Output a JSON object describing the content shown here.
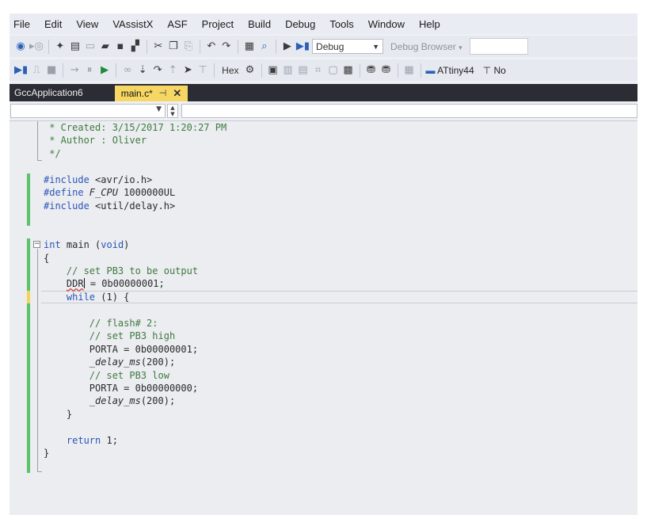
{
  "menu": [
    "File",
    "Edit",
    "View",
    "VAssistX",
    "ASF",
    "Project",
    "Build",
    "Debug",
    "Tools",
    "Window",
    "Help"
  ],
  "toolbar": {
    "config_value": "Debug",
    "debug_browser_label": "Debug Browser",
    "hex_label": "Hex",
    "device_label": "ATtiny44",
    "tool_label": "No"
  },
  "tabs": {
    "project": "GccApplication6",
    "file": "main.c*",
    "pin_glyph": "⊣",
    "close_glyph": "✕"
  },
  "editor": {
    "lines": [
      {
        "tokens": [
          {
            "t": " * Created: 3/15/2017 1:20:27 PM",
            "c": "cm"
          }
        ]
      },
      {
        "tokens": [
          {
            "t": " * Author : Oliver",
            "c": "cm"
          }
        ]
      },
      {
        "tokens": [
          {
            "t": " */",
            "c": "cm"
          }
        ]
      },
      {
        "tokens": []
      },
      {
        "tokens": [
          {
            "t": "#include ",
            "c": "kw"
          },
          {
            "t": "<avr/io.h>",
            "c": ""
          }
        ]
      },
      {
        "tokens": [
          {
            "t": "#define ",
            "c": "kw"
          },
          {
            "t": "F_CPU",
            "c": "it"
          },
          {
            "t": " 1000000UL",
            "c": ""
          }
        ]
      },
      {
        "tokens": [
          {
            "t": "#include ",
            "c": "kw"
          },
          {
            "t": "<util/delay.h>",
            "c": ""
          }
        ]
      },
      {
        "tokens": []
      },
      {
        "tokens": []
      },
      {
        "tokens": [
          {
            "t": "int",
            "c": "kw"
          },
          {
            "t": " main (",
            "c": ""
          },
          {
            "t": "void",
            "c": "kw"
          },
          {
            "t": ")",
            "c": ""
          }
        ]
      },
      {
        "tokens": [
          {
            "t": "{",
            "c": ""
          }
        ]
      },
      {
        "tokens": [
          {
            "t": "    ",
            "c": ""
          },
          {
            "t": "// set PB3 to be output",
            "c": "cm"
          }
        ]
      },
      {
        "tokens": [
          {
            "t": "    ",
            "c": ""
          },
          {
            "t": "DDR",
            "c": "squig"
          },
          {
            "t": "|",
            "c": "caret"
          },
          {
            "t": " = 0b00000001;",
            "c": ""
          }
        ]
      },
      {
        "tokens": [
          {
            "t": "    ",
            "c": ""
          },
          {
            "t": "while",
            "c": "kw"
          },
          {
            "t": " (1) {",
            "c": ""
          }
        ]
      },
      {
        "tokens": []
      },
      {
        "tokens": [
          {
            "t": "        ",
            "c": ""
          },
          {
            "t": "// flash# 2:",
            "c": "cm"
          }
        ]
      },
      {
        "tokens": [
          {
            "t": "        ",
            "c": ""
          },
          {
            "t": "// set PB3 high",
            "c": "cm"
          }
        ]
      },
      {
        "tokens": [
          {
            "t": "        PORTA = 0b00000001;",
            "c": ""
          }
        ]
      },
      {
        "tokens": [
          {
            "t": "        ",
            "c": ""
          },
          {
            "t": "_delay_ms",
            "c": "it"
          },
          {
            "t": "(200);",
            "c": ""
          }
        ]
      },
      {
        "tokens": [
          {
            "t": "        ",
            "c": ""
          },
          {
            "t": "// set PB3 low",
            "c": "cm"
          }
        ]
      },
      {
        "tokens": [
          {
            "t": "        PORTA = 0b00000000;",
            "c": ""
          }
        ]
      },
      {
        "tokens": [
          {
            "t": "        ",
            "c": ""
          },
          {
            "t": "_delay_ms",
            "c": "it"
          },
          {
            "t": "(200);",
            "c": ""
          }
        ]
      },
      {
        "tokens": [
          {
            "t": "    }",
            "c": ""
          }
        ]
      },
      {
        "tokens": []
      },
      {
        "tokens": [
          {
            "t": "    ",
            "c": ""
          },
          {
            "t": "return",
            "c": "kw"
          },
          {
            "t": " 1;",
            "c": ""
          }
        ]
      },
      {
        "tokens": [
          {
            "t": "}",
            "c": ""
          }
        ]
      }
    ]
  },
  "colors": {
    "keyword": "#2c54b8",
    "comment": "#3f7a3f",
    "tab_active": "#f6d764",
    "tab_strip": "#2c2c34",
    "changed_marker": "#5cc36a",
    "unsaved_marker": "#f3d35b"
  }
}
